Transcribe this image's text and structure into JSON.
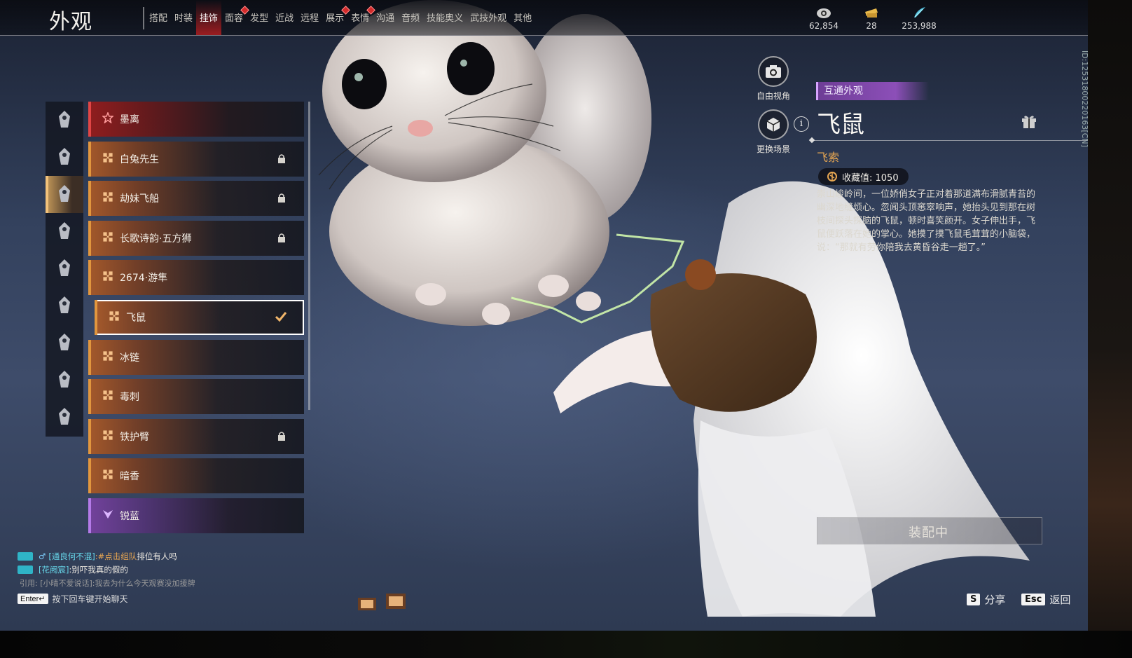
{
  "header": {
    "title": "外观",
    "tabs": [
      {
        "label": "搭配",
        "active": false,
        "dot": false
      },
      {
        "label": "时装",
        "active": false,
        "dot": false
      },
      {
        "label": "挂饰",
        "active": true,
        "dot": false
      },
      {
        "label": "面容",
        "active": false,
        "dot": true
      },
      {
        "label": "发型",
        "active": false,
        "dot": false
      },
      {
        "label": "近战",
        "active": false,
        "dot": false
      },
      {
        "label": "远程",
        "active": false,
        "dot": false
      },
      {
        "label": "展示",
        "active": false,
        "dot": true
      },
      {
        "label": "表情",
        "active": false,
        "dot": true
      },
      {
        "label": "沟通",
        "active": false,
        "dot": false
      },
      {
        "label": "音频",
        "active": false,
        "dot": false
      },
      {
        "label": "技能奥义",
        "active": false,
        "dot": false
      },
      {
        "label": "武技外观",
        "active": false,
        "dot": false
      },
      {
        "label": "其他",
        "active": false,
        "dot": false
      }
    ],
    "currencies": [
      {
        "icon": "coin-eye-icon",
        "value": "62,854",
        "color": "#d9d9d9"
      },
      {
        "icon": "ticket-icon",
        "value": "28",
        "color": "#e8b84a"
      },
      {
        "icon": "feather-icon",
        "value": "253,988",
        "color": "#4fb8d8"
      }
    ]
  },
  "categories": [
    {
      "icon": "helmet-icon",
      "active": false
    },
    {
      "icon": "mask-icon",
      "active": false
    },
    {
      "icon": "hand-accessory-icon",
      "active": true
    },
    {
      "icon": "back-accessory-icon",
      "active": false
    },
    {
      "icon": "cape-icon",
      "active": false
    },
    {
      "icon": "waist-icon",
      "active": false
    },
    {
      "icon": "face-cover-icon",
      "active": false
    },
    {
      "icon": "bow-icon",
      "active": false
    },
    {
      "icon": "demon-mask-icon",
      "active": false
    }
  ],
  "items": [
    {
      "name": "墨离",
      "rarity": "red",
      "locked": false,
      "selected": false
    },
    {
      "name": "白兔先生",
      "rarity": "orange",
      "locked": true,
      "selected": false
    },
    {
      "name": "劫妹飞船",
      "rarity": "orange",
      "locked": true,
      "selected": false
    },
    {
      "name": "长歌诗韵·五方狮",
      "rarity": "orange",
      "locked": true,
      "selected": false
    },
    {
      "name": "2674·游隼",
      "rarity": "orange",
      "locked": false,
      "selected": false
    },
    {
      "name": "飞鼠",
      "rarity": "orange",
      "locked": false,
      "selected": true
    },
    {
      "name": "冰链",
      "rarity": "orange",
      "locked": false,
      "selected": false
    },
    {
      "name": "毒刺",
      "rarity": "orange",
      "locked": false,
      "selected": false
    },
    {
      "name": "铁护臂",
      "rarity": "orange",
      "locked": true,
      "selected": false
    },
    {
      "name": "暗香",
      "rarity": "orange",
      "locked": false,
      "selected": false
    },
    {
      "name": "锐蓝",
      "rarity": "purple",
      "locked": false,
      "selected": false
    }
  ],
  "side_buttons": {
    "free_view": "自由视角",
    "change_scene": "更换场景"
  },
  "detail": {
    "tag": "互通外观",
    "title": "飞鼠",
    "category": "飞索",
    "collect_label": "收藏值: 1050",
    "description": "崇山峻岭间，一位娇俏女子正对着那道满布滑腻青苔的幽深地缝烦心。忽闻头顶窸窣响声，她抬头见到那在树枝间探头探脑的飞鼠，顿时喜笑颜开。女子伸出手，飞鼠便跃落在她的掌心。她摸了摸飞鼠毛茸茸的小脑袋，说：“那就有劳你陪我去黄昏谷走一趟了。”",
    "equip_status": "装配中",
    "uid": "ID:12531800220163[CN]"
  },
  "chat": {
    "lines": [
      {
        "channel": "[通良何不混]",
        "action": ":#点击组队",
        "message": " 排位有人吗"
      },
      {
        "channel": "[花阙宸]",
        "action": "",
        "message": ":别吓我真的假的"
      }
    ],
    "quote": "引用: [小晴不爱说话]:我去为什么今天观赛没加援牌",
    "enter_key": "Enter↵",
    "hint": "按下回车键开始聊天"
  },
  "hotkeys": {
    "share_key": "S",
    "share_label": "分享",
    "back_key": "Esc",
    "back_label": "返回"
  },
  "colors": {
    "accent_orange": "#e1963e",
    "accent_red": "#e04545",
    "accent_purple": "#b47ae8",
    "tag_purple": "#8c4fb8",
    "category_gold": "#e8a752"
  }
}
